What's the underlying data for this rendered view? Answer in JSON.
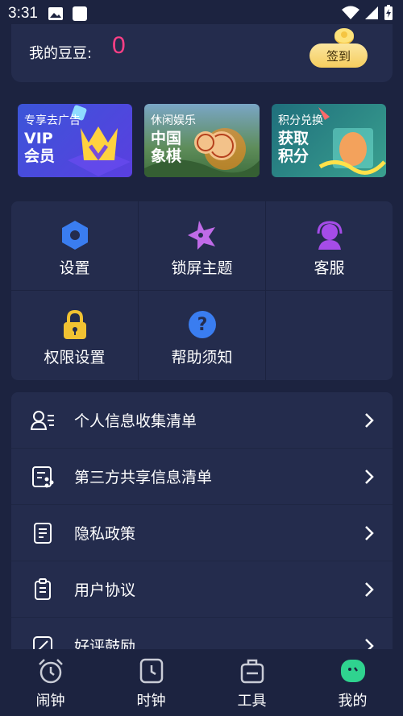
{
  "status_bar": {
    "time": "3:31"
  },
  "beans": {
    "label": "我的豆豆:",
    "value": "0",
    "signin_label": "签到"
  },
  "banners": [
    {
      "tag": "专享去广告",
      "title_line1": "VIP",
      "title_line2": "会员"
    },
    {
      "tag": "休闲娱乐",
      "title_line1": "中国",
      "title_line2": "象棋"
    },
    {
      "tag": "积分兑换",
      "title_line1": "获取",
      "title_line2": "积分"
    }
  ],
  "grid": {
    "settings": "设置",
    "lock_theme": "锁屏主题",
    "service": "客服",
    "permissions": "权限设置",
    "help": "帮助须知"
  },
  "list": {
    "personal_info": "个人信息收集清单",
    "third_party": "第三方共享信息清单",
    "privacy": "隐私政策",
    "user_agreement": "用户协议",
    "rating": "好评鼓励"
  },
  "tabs": {
    "alarm": "闹钟",
    "clock": "时钟",
    "tools": "工具",
    "mine": "我的"
  },
  "colors": {
    "background": "#1c2340",
    "card": "#242c4d",
    "beans_value": "#ff3f86",
    "signin_button": "#f5cd5e",
    "active_tab": "#2fd38f"
  }
}
